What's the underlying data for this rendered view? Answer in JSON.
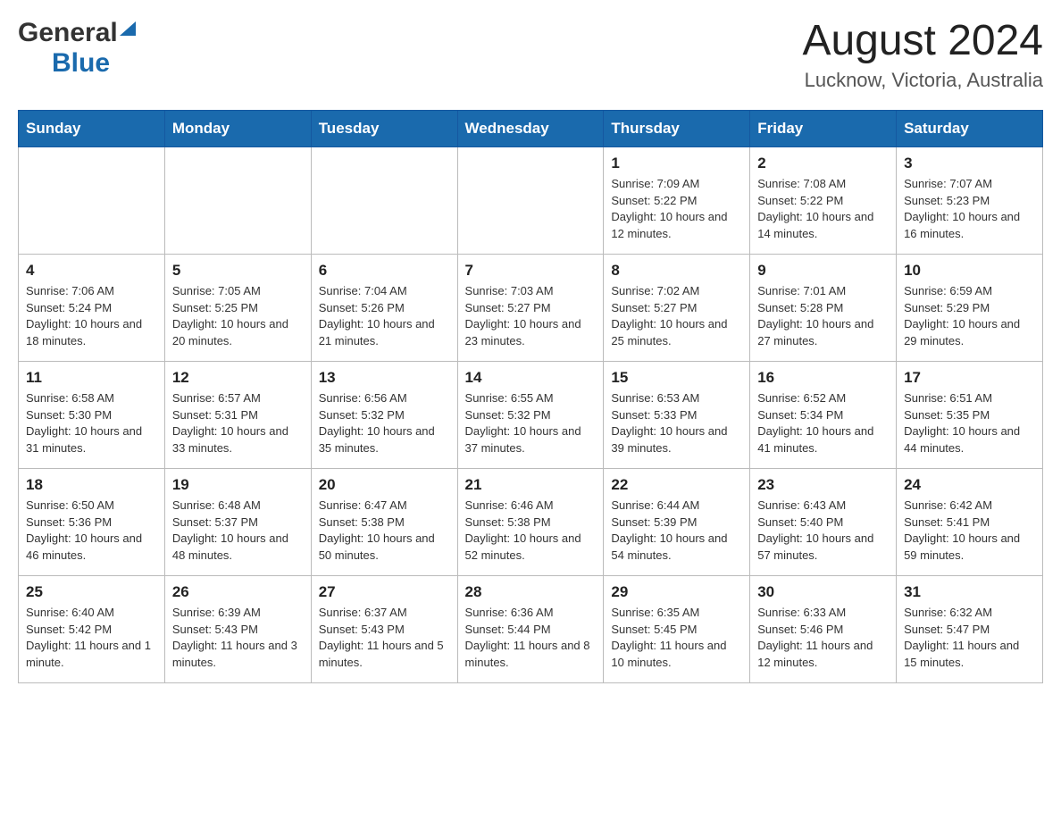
{
  "header": {
    "logo_general": "General",
    "logo_blue": "Blue",
    "month_title": "August 2024",
    "location": "Lucknow, Victoria, Australia"
  },
  "weekdays": [
    "Sunday",
    "Monday",
    "Tuesday",
    "Wednesday",
    "Thursday",
    "Friday",
    "Saturday"
  ],
  "weeks": [
    [
      {
        "day": "",
        "info": ""
      },
      {
        "day": "",
        "info": ""
      },
      {
        "day": "",
        "info": ""
      },
      {
        "day": "",
        "info": ""
      },
      {
        "day": "1",
        "info": "Sunrise: 7:09 AM\nSunset: 5:22 PM\nDaylight: 10 hours and 12 minutes."
      },
      {
        "day": "2",
        "info": "Sunrise: 7:08 AM\nSunset: 5:22 PM\nDaylight: 10 hours and 14 minutes."
      },
      {
        "day": "3",
        "info": "Sunrise: 7:07 AM\nSunset: 5:23 PM\nDaylight: 10 hours and 16 minutes."
      }
    ],
    [
      {
        "day": "4",
        "info": "Sunrise: 7:06 AM\nSunset: 5:24 PM\nDaylight: 10 hours and 18 minutes."
      },
      {
        "day": "5",
        "info": "Sunrise: 7:05 AM\nSunset: 5:25 PM\nDaylight: 10 hours and 20 minutes."
      },
      {
        "day": "6",
        "info": "Sunrise: 7:04 AM\nSunset: 5:26 PM\nDaylight: 10 hours and 21 minutes."
      },
      {
        "day": "7",
        "info": "Sunrise: 7:03 AM\nSunset: 5:27 PM\nDaylight: 10 hours and 23 minutes."
      },
      {
        "day": "8",
        "info": "Sunrise: 7:02 AM\nSunset: 5:27 PM\nDaylight: 10 hours and 25 minutes."
      },
      {
        "day": "9",
        "info": "Sunrise: 7:01 AM\nSunset: 5:28 PM\nDaylight: 10 hours and 27 minutes."
      },
      {
        "day": "10",
        "info": "Sunrise: 6:59 AM\nSunset: 5:29 PM\nDaylight: 10 hours and 29 minutes."
      }
    ],
    [
      {
        "day": "11",
        "info": "Sunrise: 6:58 AM\nSunset: 5:30 PM\nDaylight: 10 hours and 31 minutes."
      },
      {
        "day": "12",
        "info": "Sunrise: 6:57 AM\nSunset: 5:31 PM\nDaylight: 10 hours and 33 minutes."
      },
      {
        "day": "13",
        "info": "Sunrise: 6:56 AM\nSunset: 5:32 PM\nDaylight: 10 hours and 35 minutes."
      },
      {
        "day": "14",
        "info": "Sunrise: 6:55 AM\nSunset: 5:32 PM\nDaylight: 10 hours and 37 minutes."
      },
      {
        "day": "15",
        "info": "Sunrise: 6:53 AM\nSunset: 5:33 PM\nDaylight: 10 hours and 39 minutes."
      },
      {
        "day": "16",
        "info": "Sunrise: 6:52 AM\nSunset: 5:34 PM\nDaylight: 10 hours and 41 minutes."
      },
      {
        "day": "17",
        "info": "Sunrise: 6:51 AM\nSunset: 5:35 PM\nDaylight: 10 hours and 44 minutes."
      }
    ],
    [
      {
        "day": "18",
        "info": "Sunrise: 6:50 AM\nSunset: 5:36 PM\nDaylight: 10 hours and 46 minutes."
      },
      {
        "day": "19",
        "info": "Sunrise: 6:48 AM\nSunset: 5:37 PM\nDaylight: 10 hours and 48 minutes."
      },
      {
        "day": "20",
        "info": "Sunrise: 6:47 AM\nSunset: 5:38 PM\nDaylight: 10 hours and 50 minutes."
      },
      {
        "day": "21",
        "info": "Sunrise: 6:46 AM\nSunset: 5:38 PM\nDaylight: 10 hours and 52 minutes."
      },
      {
        "day": "22",
        "info": "Sunrise: 6:44 AM\nSunset: 5:39 PM\nDaylight: 10 hours and 54 minutes."
      },
      {
        "day": "23",
        "info": "Sunrise: 6:43 AM\nSunset: 5:40 PM\nDaylight: 10 hours and 57 minutes."
      },
      {
        "day": "24",
        "info": "Sunrise: 6:42 AM\nSunset: 5:41 PM\nDaylight: 10 hours and 59 minutes."
      }
    ],
    [
      {
        "day": "25",
        "info": "Sunrise: 6:40 AM\nSunset: 5:42 PM\nDaylight: 11 hours and 1 minute."
      },
      {
        "day": "26",
        "info": "Sunrise: 6:39 AM\nSunset: 5:43 PM\nDaylight: 11 hours and 3 minutes."
      },
      {
        "day": "27",
        "info": "Sunrise: 6:37 AM\nSunset: 5:43 PM\nDaylight: 11 hours and 5 minutes."
      },
      {
        "day": "28",
        "info": "Sunrise: 6:36 AM\nSunset: 5:44 PM\nDaylight: 11 hours and 8 minutes."
      },
      {
        "day": "29",
        "info": "Sunrise: 6:35 AM\nSunset: 5:45 PM\nDaylight: 11 hours and 10 minutes."
      },
      {
        "day": "30",
        "info": "Sunrise: 6:33 AM\nSunset: 5:46 PM\nDaylight: 11 hours and 12 minutes."
      },
      {
        "day": "31",
        "info": "Sunrise: 6:32 AM\nSunset: 5:47 PM\nDaylight: 11 hours and 15 minutes."
      }
    ]
  ]
}
